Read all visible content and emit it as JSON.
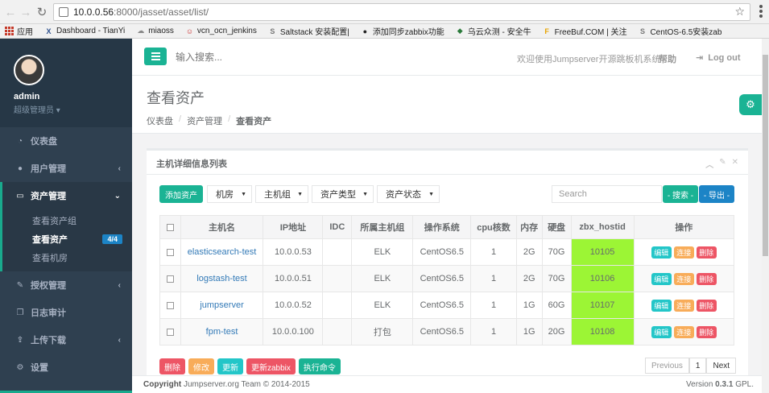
{
  "browser": {
    "url_host": "10.0.0.56",
    "url_path": ":8000/jasset/asset/list/",
    "bookmarks": [
      {
        "label": "应用",
        "icon": "apps-grid-icon"
      },
      {
        "label": "Dashboard - TianYi",
        "icon": "x-logo-icon"
      },
      {
        "label": "miaoss",
        "icon": "cloud-icon"
      },
      {
        "label": "vcn_ocn_jenkins",
        "icon": "jenkins-icon"
      },
      {
        "label": "Saltstack 安装配置|",
        "icon": "salt-icon"
      },
      {
        "label": "添加同步zabbix功能",
        "icon": "github-icon"
      },
      {
        "label": "乌云众测 - 安全牛",
        "icon": "shield-icon"
      },
      {
        "label": "FreeBuf.COM | 关注",
        "icon": "f-logo-icon"
      },
      {
        "label": "CentOS-6.5安装zab",
        "icon": "salt-icon"
      }
    ]
  },
  "sidebar": {
    "username": "admin",
    "role": "超级管理员",
    "items": [
      {
        "label": "仪表盘",
        "icon": "dashboard-icon"
      },
      {
        "label": "用户管理",
        "icon": "users-icon"
      },
      {
        "label": "资产管理",
        "icon": "server-icon"
      },
      {
        "label": "授权管理",
        "icon": "edit-icon"
      },
      {
        "label": "日志审计",
        "icon": "copy-icon"
      },
      {
        "label": "上传下载",
        "icon": "upload-icon"
      },
      {
        "label": "设置",
        "icon": "gears-icon"
      }
    ],
    "submenu": [
      {
        "label": "查看资产组"
      },
      {
        "label": "查看资产",
        "badge": "4/4"
      },
      {
        "label": "查看机房"
      }
    ]
  },
  "topbar": {
    "search_placeholder": "输入搜索...",
    "welcome": "欢迎使用Jumpserver开源跳板机系统",
    "help": "帮助",
    "logout": "Log out"
  },
  "page": {
    "title": "查看资产",
    "breadcrumb": [
      "仪表盘",
      "资产管理",
      "查看资产"
    ]
  },
  "panel": {
    "title": "主机详细信息列表",
    "add_button": "添加资产",
    "filters": [
      "机房",
      "主机组",
      "资产类型",
      "资产状态"
    ],
    "search_placeholder": "Search",
    "search_button": "- 搜索 -",
    "export_button": "- 导出 -",
    "columns": [
      "主机名",
      "IP地址",
      "IDC",
      "所属主机组",
      "操作系统",
      "cpu核数",
      "内存",
      "硬盘",
      "zbx_hostid",
      "操作"
    ],
    "row_actions": [
      "编辑",
      "连接",
      "删除"
    ],
    "rows": [
      {
        "hostname": "elasticsearch-test",
        "ip": "10.0.0.53",
        "idc": "",
        "group": "ELK",
        "os": "CentOS6.5",
        "cpu": "1",
        "mem": "2G",
        "disk": "70G",
        "zbx": "10105"
      },
      {
        "hostname": "logstash-test",
        "ip": "10.0.0.51",
        "idc": "",
        "group": "ELK",
        "os": "CentOS6.5",
        "cpu": "1",
        "mem": "2G",
        "disk": "70G",
        "zbx": "10106"
      },
      {
        "hostname": "jumpserver",
        "ip": "10.0.0.52",
        "idc": "",
        "group": "ELK",
        "os": "CentOS6.5",
        "cpu": "1",
        "mem": "1G",
        "disk": "60G",
        "zbx": "10107"
      },
      {
        "hostname": "fpm-test",
        "ip": "10.0.0.100",
        "idc": "",
        "group": "打包",
        "os": "CentOS6.5",
        "cpu": "1",
        "mem": "1G",
        "disk": "20G",
        "zbx": "10108"
      }
    ],
    "bulk_actions": [
      "删除",
      "修改",
      "更新",
      "更新zabbix",
      "执行命令"
    ],
    "pager": {
      "prev": "Previous",
      "page": "1",
      "next": "Next"
    }
  },
  "footer": {
    "copyright_bold": "Copyright",
    "copyright_text": " Jumpserver.org Team © 2014-2015",
    "version_label": "Version ",
    "version": "0.3.1",
    "license": " GPL."
  },
  "colors": {
    "primary": "#1ab394",
    "sidebar": "#2f4050",
    "zbx_highlight": "#9cf535",
    "danger": "#ed5565",
    "warning": "#f8ac59",
    "info": "#23c6c8"
  }
}
